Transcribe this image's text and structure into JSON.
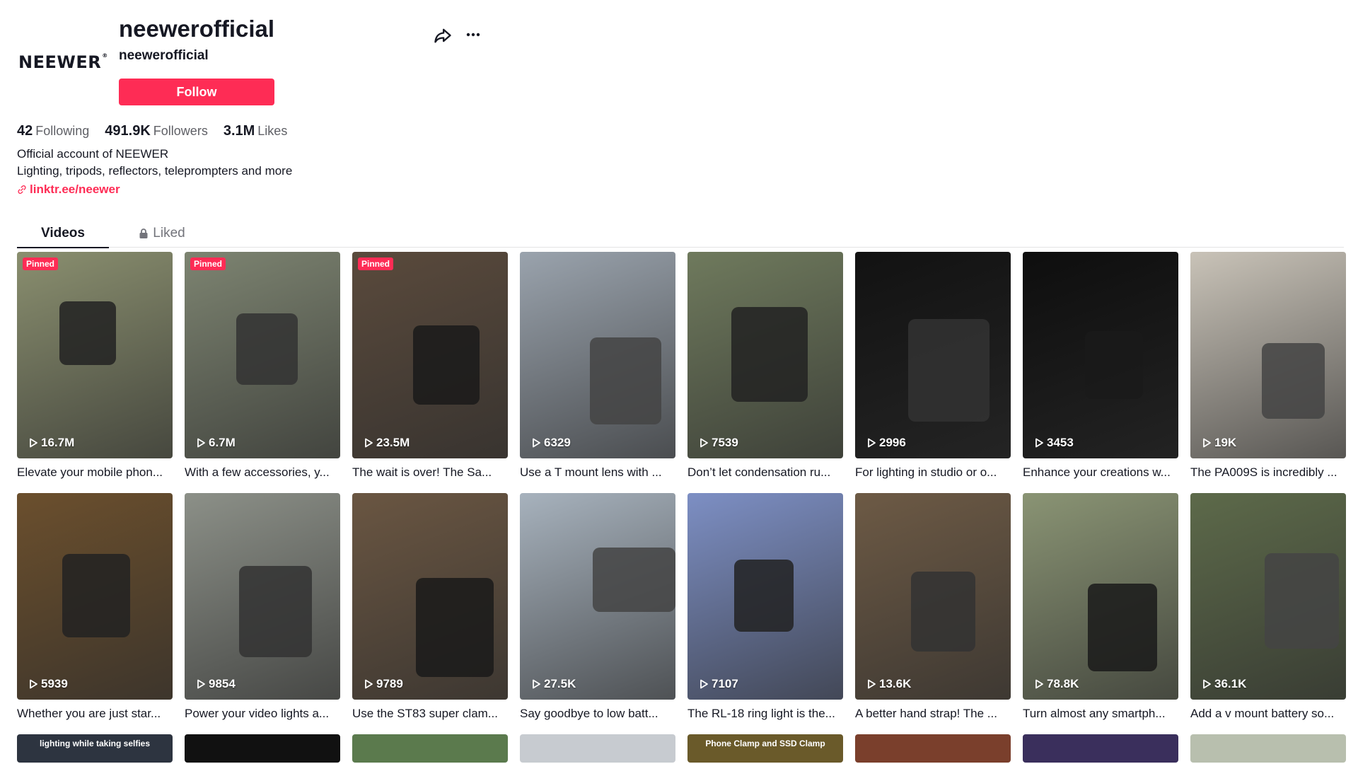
{
  "profile": {
    "logo_text": "NEEWER",
    "username": "neewerofficial",
    "nickname": "neewerofficial",
    "follow_label": "Follow",
    "stats": [
      {
        "value": "42",
        "label": "Following"
      },
      {
        "value": "491.9K",
        "label": "Followers"
      },
      {
        "value": "3.1M",
        "label": "Likes"
      }
    ],
    "bio_line1": "Official account of NEEWER",
    "bio_line2": "Lighting, tripods, reflectors, teleprompters and more",
    "link": "linktr.ee/neewer"
  },
  "tabs": [
    {
      "label": "Videos",
      "active": true
    },
    {
      "label": "Liked",
      "active": false,
      "icon": "lock-icon"
    }
  ],
  "videos_row1": [
    {
      "views": "16.7M",
      "desc": "Elevate your mobile phon...",
      "pinned": "Pinned",
      "bg": "#8a8f6f"
    },
    {
      "views": "6.7M",
      "desc": "With a few accessories, y...",
      "pinned": "Pinned",
      "bg": "#7d8471"
    },
    {
      "views": "23.5M",
      "desc": "The wait is over! The Sa...",
      "pinned": "Pinned",
      "bg": "#5a4a3c"
    },
    {
      "views": "6329",
      "desc": "Use a T mount lens with ...",
      "pinned": "",
      "bg": "#9aa3ad"
    },
    {
      "views": "7539",
      "desc": "Don’t let condensation ru...",
      "pinned": "",
      "bg": "#6f7a5d"
    },
    {
      "views": "2996",
      "desc": "For lighting in studio or o...",
      "pinned": "",
      "bg": "#121212"
    },
    {
      "views": "3453",
      "desc": "Enhance your creations w...",
      "pinned": "",
      "bg": "#0e0e0e"
    },
    {
      "views": "19K",
      "desc": "The PA009S is incredibly ...",
      "pinned": "",
      "bg": "#c9c3b8"
    }
  ],
  "videos_row2": [
    {
      "views": "5939",
      "desc": "Whether you are just star...",
      "pinned": "",
      "bg": "#6b4f2d"
    },
    {
      "views": "9854",
      "desc": "Power your video lights a...",
      "pinned": "",
      "bg": "#8c9088"
    },
    {
      "views": "9789",
      "desc": "Use the ST83 super clam...",
      "pinned": "",
      "bg": "#6a5642"
    },
    {
      "views": "27.5K",
      "desc": "Say goodbye to low batt...",
      "pinned": "",
      "bg": "#a7b2bd"
    },
    {
      "views": "7107",
      "desc": "The RL-18 ring light is the...",
      "pinned": "",
      "bg": "#7d8fc4"
    },
    {
      "views": "13.6K",
      "desc": "A better hand strap! The ...",
      "pinned": "",
      "bg": "#6d5a45"
    },
    {
      "views": "78.8K",
      "desc": "Turn almost any smartph...",
      "pinned": "",
      "bg": "#8a9474"
    },
    {
      "views": "36.1K",
      "desc": "Add a v mount battery so...",
      "pinned": "",
      "bg": "#5d6a4a"
    }
  ],
  "videos_row3": [
    {
      "bg": "#2d3440",
      "caption": "lighting while taking selfies"
    },
    {
      "bg": "#111111",
      "caption": ""
    },
    {
      "bg": "#5b7a4d",
      "caption": ""
    },
    {
      "bg": "#c7cbd0",
      "caption": ""
    },
    {
      "bg": "#6a5a2a",
      "caption": "Phone Clamp and SSD Clamp"
    },
    {
      "bg": "#7a3f2c",
      "caption": ""
    },
    {
      "bg": "#3a2f5c",
      "caption": ""
    },
    {
      "bg": "#b8bfae",
      "caption": ""
    }
  ],
  "icons": {
    "share": "share-icon",
    "more": "more-icon",
    "link": "link-icon",
    "lock": "lock-icon",
    "play": "play-icon"
  },
  "colors": {
    "accent": "#fe2c55",
    "text": "#161823",
    "muted": "#5f6066"
  }
}
